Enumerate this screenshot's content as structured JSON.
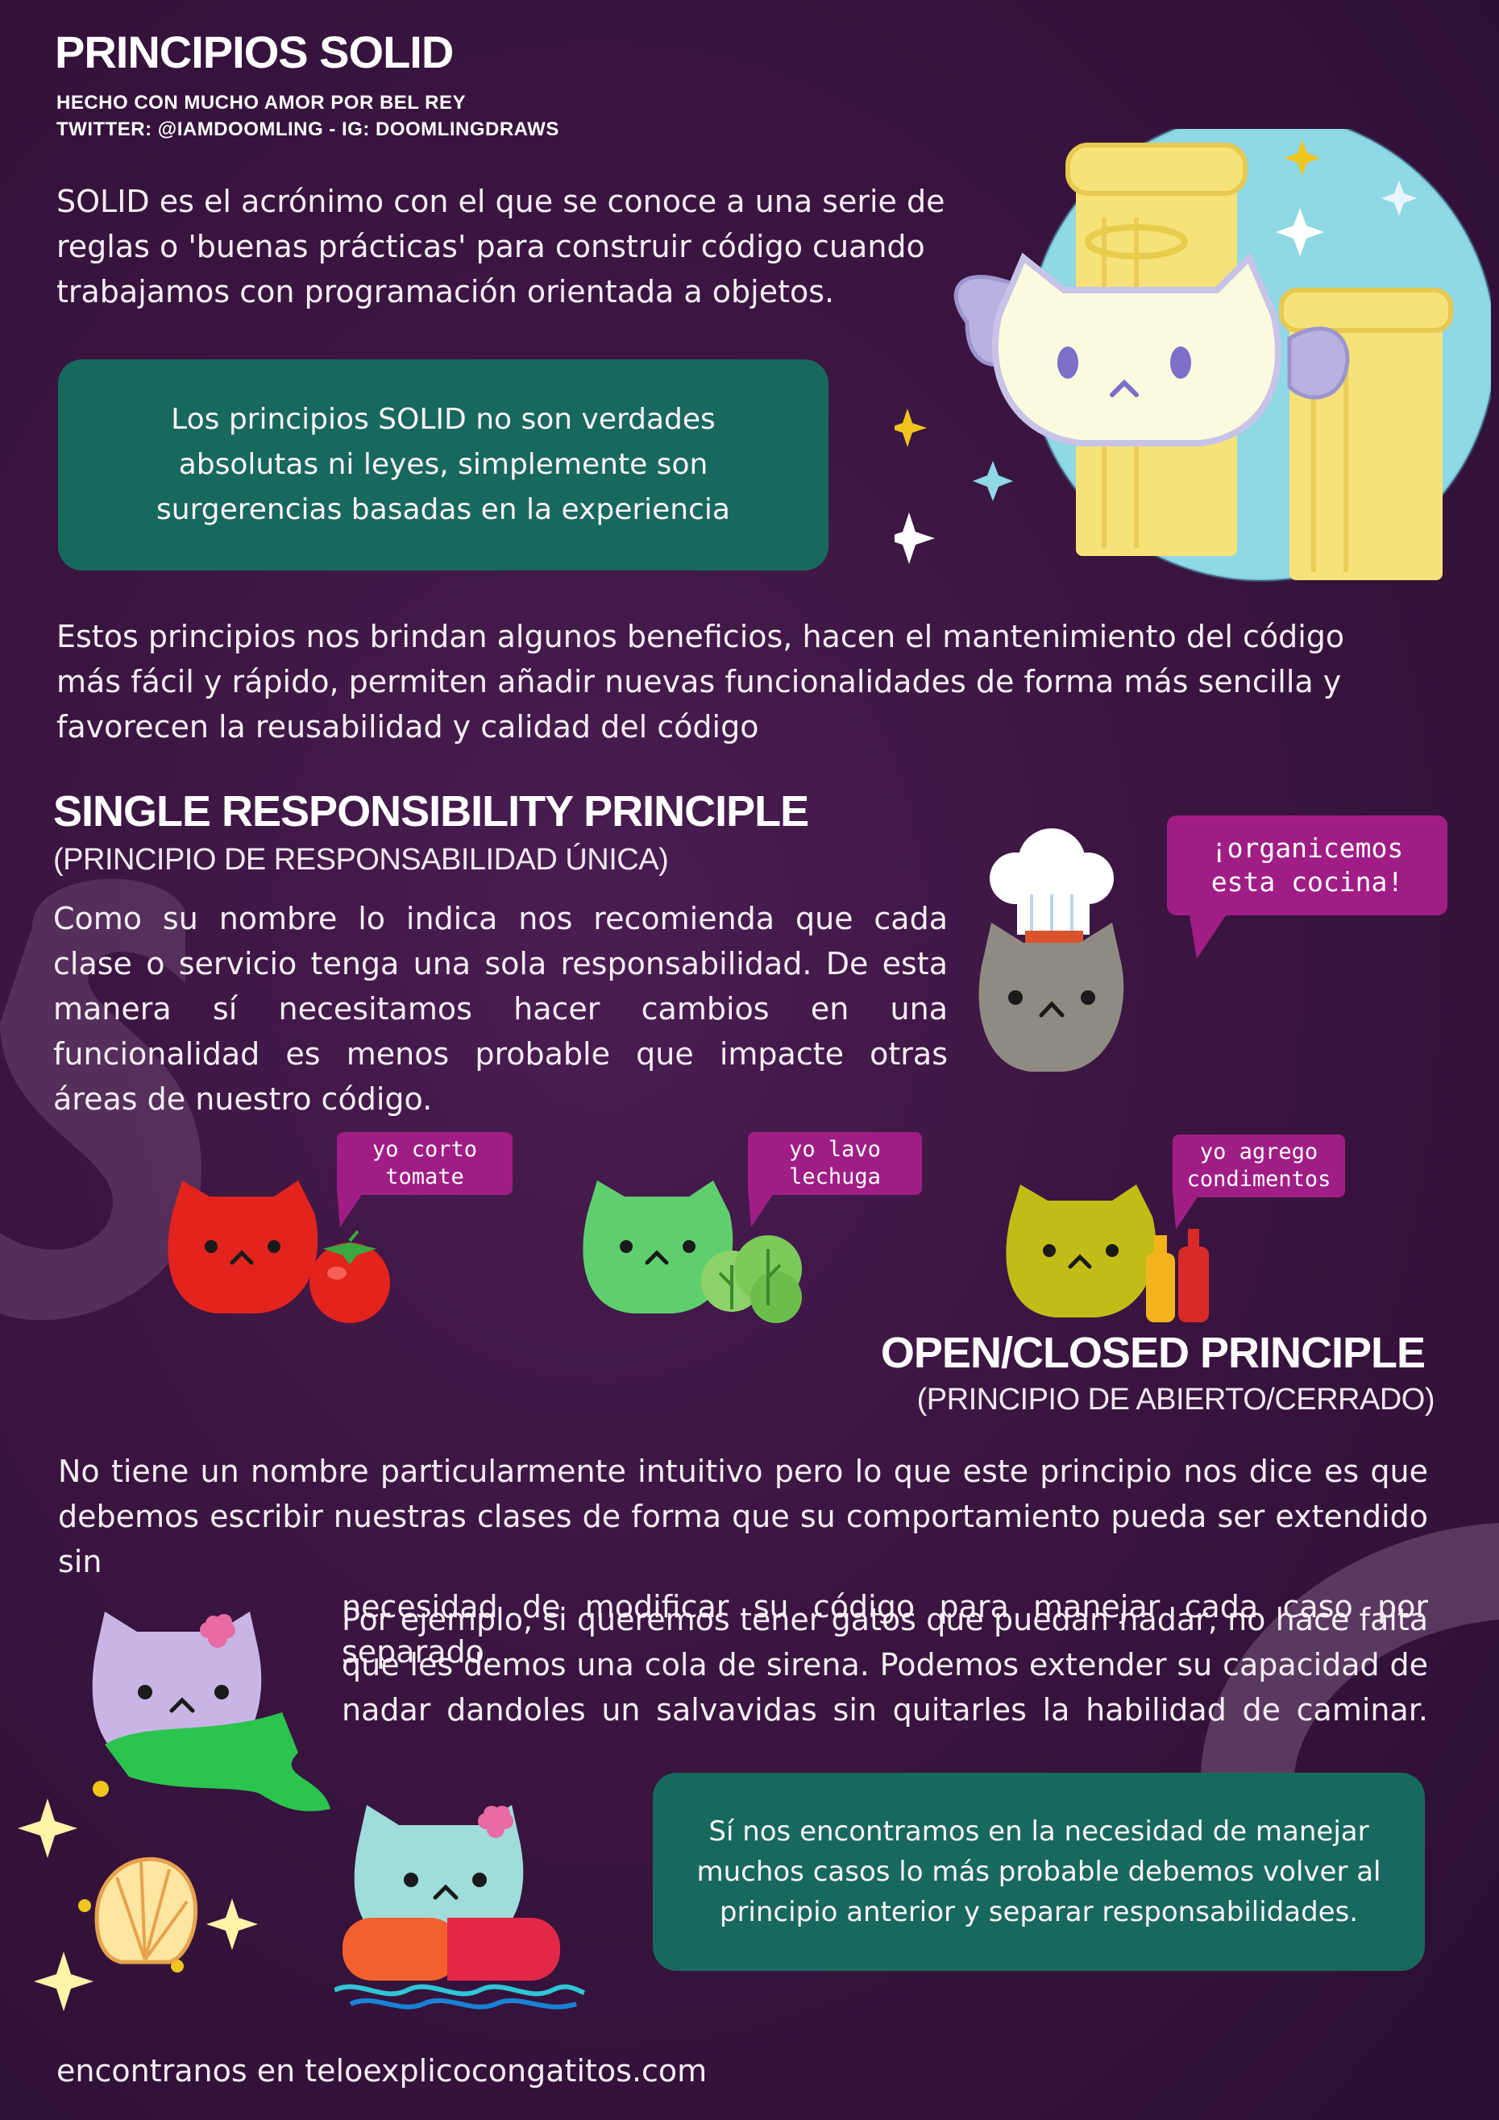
{
  "header": {
    "title": "PRINCIPIOS SOLID",
    "credit_line1": "HECHO CON MUCHO AMOR POR BEL REY",
    "credit_line2": "TWITTER: @IAMDOOMLING - IG: DOOMLINGDRAWS"
  },
  "intro": {
    "lines": [
      "SOLID es el acrónimo con el que se conoce a una serie de",
      "reglas o 'buenas prácticas' para construir código cuando",
      "trabajamos con programación orientada a objetos."
    ],
    "note_lines": [
      "Los principios SOLID no son verdades",
      "absolutas ni leyes, simplemente son",
      "surgerencias basadas en la experiencia"
    ],
    "benefits_lines": [
      "Estos principios nos brindan algunos beneficios, hacen el mantenimiento del código",
      "más fácil y rápido, permiten añadir nuevas funcionalidades de forma más sencilla y",
      "favorecen la reusabilidad y calidad del código"
    ]
  },
  "srp": {
    "title": "SINGLE RESPONSIBILITY PRINCIPLE",
    "subtitle": "(PRINCIPIO DE RESPONSABILIDAD ÚNICA)",
    "lines": [
      "Como su nombre lo indica nos recomienda que cada",
      "clase o servicio tenga una sola responsabilidad. De esta",
      "manera sí necesitamos hacer cambios en una",
      "funcionalidad es menos probable que impacte otras",
      "áreas de nuestro código."
    ],
    "chef_bubble": "¡organicemos\nesta cocina!",
    "cats": [
      {
        "bubble": "yo corto\ntomate",
        "color": "#e3231d",
        "item": "tomato-icon"
      },
      {
        "bubble": "yo lavo\nlechuga",
        "color": "#5fcf6e",
        "item": "lettuce-icon"
      },
      {
        "bubble": "yo agrego\ncondimentos",
        "color": "#c2bc17",
        "item": "condiments-icon"
      }
    ]
  },
  "ocp": {
    "title": "OPEN/CLOSED PRINCIPLE",
    "subtitle": "(PRINCIPIO DE ABIERTO/CERRADO)",
    "lines_full": [
      "No tiene un nombre particularmente intuitivo pero lo que este principio nos dice es que",
      "debemos escribir nuestras clases de forma que su comportamiento pueda ser extendido sin"
    ],
    "line_indent": "necesidad de modificar su código para manejar cada caso por separado.",
    "example_lines": [
      "Por ejemplo, si queremos tener gatos que puedan nadar, no hace falta",
      "que les demos una cola de sirena. Podemos extender su capacidad de",
      "nadar dandoles un salvavidas sin quitarles la habilidad de caminar."
    ],
    "note_lines": [
      "Sí nos encontramos en la necesidad de manejar",
      "muchos casos lo más probable debemos volver al",
      "principio anterior y separar responsabilidades."
    ]
  },
  "footer": {
    "text": "encontranos en teloexplicocongatitos.com"
  },
  "colors": {
    "background": "#3a1540",
    "note_box": "#17695e",
    "bubble": "#a11d86",
    "white_cat": "#fbfadf",
    "chef_cat": "#8f8b82",
    "mermaid_cat": "#c9b4e6",
    "float_cat": "#9fdcdc"
  }
}
